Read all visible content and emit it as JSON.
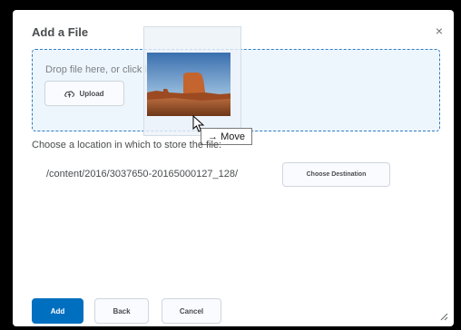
{
  "dialog": {
    "title": "Add a File",
    "close_label": "×"
  },
  "dropzone": {
    "prompt": "Drop file here, or click below!",
    "upload_label": "Upload",
    "upload_icon": "cloud-upload-icon"
  },
  "drag": {
    "tooltip": "→ Move",
    "thumbnail_icon": "desert-mesa-image"
  },
  "location": {
    "label": "Choose a location in which to store the file:",
    "path": "/content/2016/3037650-20165000127_128/",
    "choose_label": "Choose Destination"
  },
  "footer": {
    "add_label": "Add",
    "back_label": "Back",
    "cancel_label": "Cancel"
  },
  "colors": {
    "primary": "#006fbf",
    "dropzone_border": "#2e7cc5",
    "dropzone_bg": "#eef6fd",
    "text": "#494c4e"
  }
}
